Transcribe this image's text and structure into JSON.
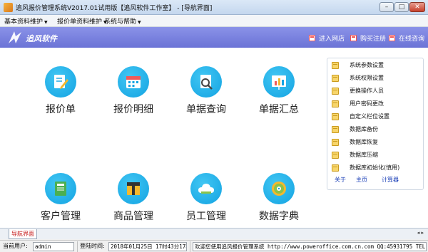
{
  "window": {
    "title": "追风报价管理系统V2017.01试用版【追风软件工作室】 - [导航界面]",
    "minimize": "–",
    "maximize": "□",
    "close": "✕"
  },
  "menu": {
    "items": [
      {
        "label": "基本资料维护"
      },
      {
        "label": "报价单资料维护"
      },
      {
        "label": "系统与帮助"
      }
    ]
  },
  "header": {
    "logo_text": "追风软件",
    "links": [
      {
        "label": "进入网店"
      },
      {
        "label": "购买注册"
      },
      {
        "label": "在线咨询"
      }
    ]
  },
  "tiles": [
    {
      "label": "报价单",
      "icon": "pencil-doc-icon"
    },
    {
      "label": "报价明细",
      "icon": "calendar-icon"
    },
    {
      "label": "单据查询",
      "icon": "magnifier-doc-icon"
    },
    {
      "label": "单据汇总",
      "icon": "bar-chart-icon"
    },
    {
      "label": "客户管理",
      "icon": "address-book-icon"
    },
    {
      "label": "商品管理",
      "icon": "box-icon"
    },
    {
      "label": "员工管理",
      "icon": "cloud-icon"
    },
    {
      "label": "数据字典",
      "icon": "disc-icon"
    }
  ],
  "side_panel": {
    "items": [
      {
        "label": "系统参数设置"
      },
      {
        "label": "系统权限设置"
      },
      {
        "label": "更换操作人员"
      },
      {
        "label": "用户密码更改"
      },
      {
        "label": "自定义栏位设置"
      },
      {
        "label": "数据库备份"
      },
      {
        "label": "数据库恢复"
      },
      {
        "label": "数据库压缩"
      },
      {
        "label": "数据库初始化(慎用)"
      }
    ],
    "links": [
      {
        "label": "关于"
      },
      {
        "label": "主页"
      },
      {
        "label": "计算器"
      }
    ]
  },
  "tabs": {
    "active": "导航界面",
    "arrows": "◂ ▸"
  },
  "status": {
    "user_label": "当前用户:",
    "user_value": "admin",
    "login_label": "登陆时间:",
    "login_value": "2018年01月25日 17时43分17秒",
    "message": "欢迎您使用追风报价管理系统 http://www.poweroffice.com.cn.com QQ:45931795 TEL:1"
  },
  "colors": {
    "header": "#7a82e0",
    "tile_circle": "#1eaee8",
    "link": "#1a3fb7",
    "tab_text": "#c51919"
  }
}
